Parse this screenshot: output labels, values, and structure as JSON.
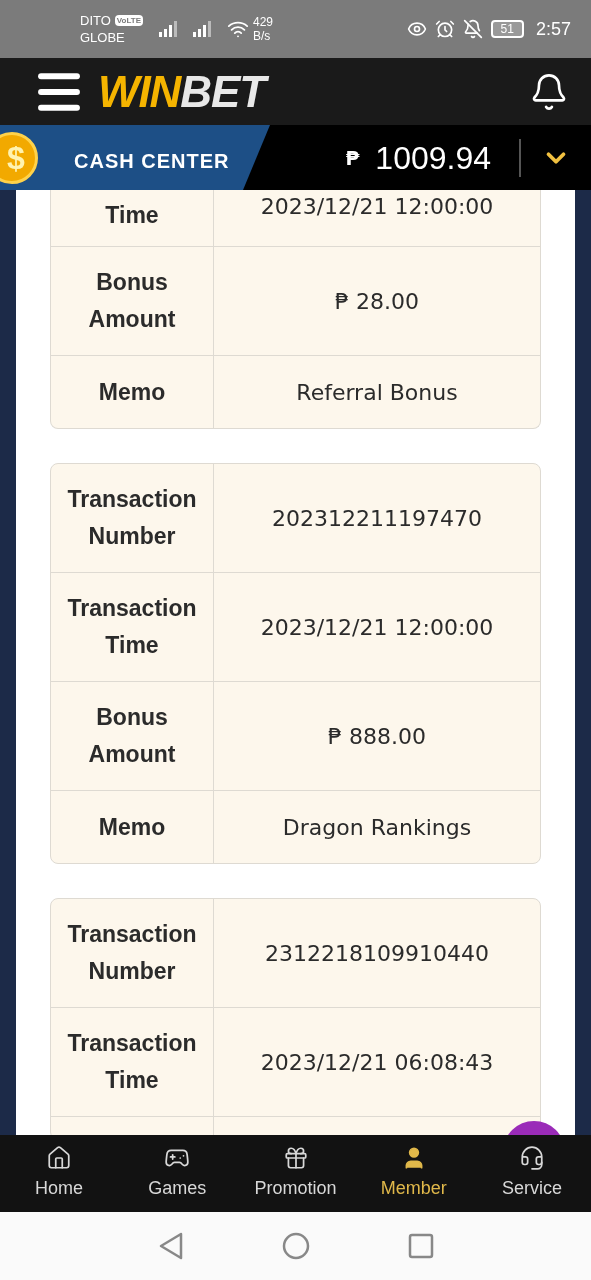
{
  "status_bar": {
    "carrier_1": "DITO",
    "volte": "VoLTE",
    "carrier_2": "GLOBE",
    "speed": "429",
    "speed_unit": "B/s",
    "battery": "51",
    "time": "2:57"
  },
  "header": {
    "logo": [
      "WIN",
      "BET"
    ]
  },
  "cash_center": {
    "coin_symbol": "$",
    "label": "CASH CENTER",
    "currency": "₱",
    "balance": "1009.94"
  },
  "cards": [
    {
      "rows": [
        {
          "kind": "cut_top",
          "label": "Time",
          "value": "2023/12/21 12:00:00"
        },
        {
          "kind": "full",
          "label": "Bonus Amount",
          "value": "₱ 28.00"
        },
        {
          "kind": "short",
          "label": "Memo",
          "value": "Referral Bonus"
        }
      ]
    },
    {
      "rows": [
        {
          "kind": "full",
          "label": "Transaction Number",
          "value": "202312211197470"
        },
        {
          "kind": "full",
          "label": "Transaction Time",
          "value": "2023/12/21 12:00:00"
        },
        {
          "kind": "full",
          "label": "Bonus Amount",
          "value": "₱ 888.00"
        },
        {
          "kind": "short",
          "label": "Memo",
          "value": "Dragon Rankings"
        }
      ]
    },
    {
      "rows": [
        {
          "kind": "full",
          "label": "Transaction Number",
          "value": "2312218109910440"
        },
        {
          "kind": "full",
          "label": "Transaction Time",
          "value": "2023/12/21 06:08:43"
        },
        {
          "kind": "cut_bottom"
        }
      ]
    }
  ],
  "nav": [
    {
      "kind": "home",
      "label": "Home",
      "selected": false
    },
    {
      "kind": "games",
      "label": "Games",
      "selected": false
    },
    {
      "kind": "promotion",
      "label": "Promotion",
      "selected": false
    },
    {
      "kind": "member",
      "label": "Member",
      "selected": true
    },
    {
      "kind": "service",
      "label": "Service",
      "selected": false
    }
  ]
}
